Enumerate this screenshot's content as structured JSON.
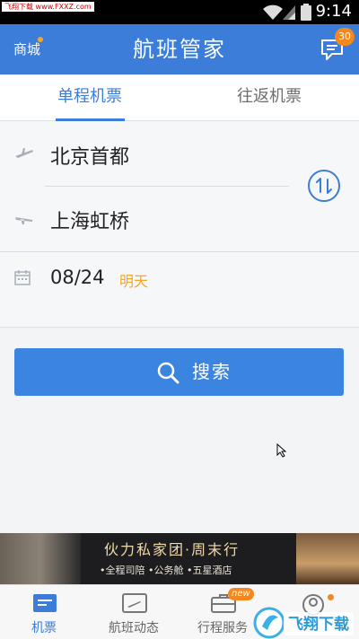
{
  "status_bar": {
    "watermark": "飞翔下载 www.FXXZ.com",
    "time": "9:14"
  },
  "header": {
    "mall_label": "商城",
    "title": "航班管家",
    "message_count": "30"
  },
  "tabs": [
    {
      "label": "单程机票",
      "active": true
    },
    {
      "label": "往返机票",
      "active": false
    }
  ],
  "form": {
    "departure_city": "北京首都",
    "arrival_city": "上海虹桥",
    "date": "08/24",
    "date_tag": "明天"
  },
  "search_button": {
    "label": "搜索"
  },
  "banner": {
    "title": "伙力私家团·周末行",
    "subtitle": "•全程司陪 •公务舱 •五星酒店"
  },
  "bottom_nav": [
    {
      "label": "机票",
      "icon": "ticket-icon",
      "active": true
    },
    {
      "label": "航班动态",
      "icon": "flight-status-icon",
      "active": false
    },
    {
      "label": "行程服务",
      "icon": "briefcase-icon",
      "active": false,
      "badge": "new"
    },
    {
      "label": "",
      "icon": "profile-icon",
      "active": false
    }
  ],
  "logo_overlay": {
    "text": "飞翔下载"
  },
  "colors": {
    "primary": "#3b7dd8",
    "accent_orange": "#f5a623",
    "badge_orange": "#f5871f"
  }
}
